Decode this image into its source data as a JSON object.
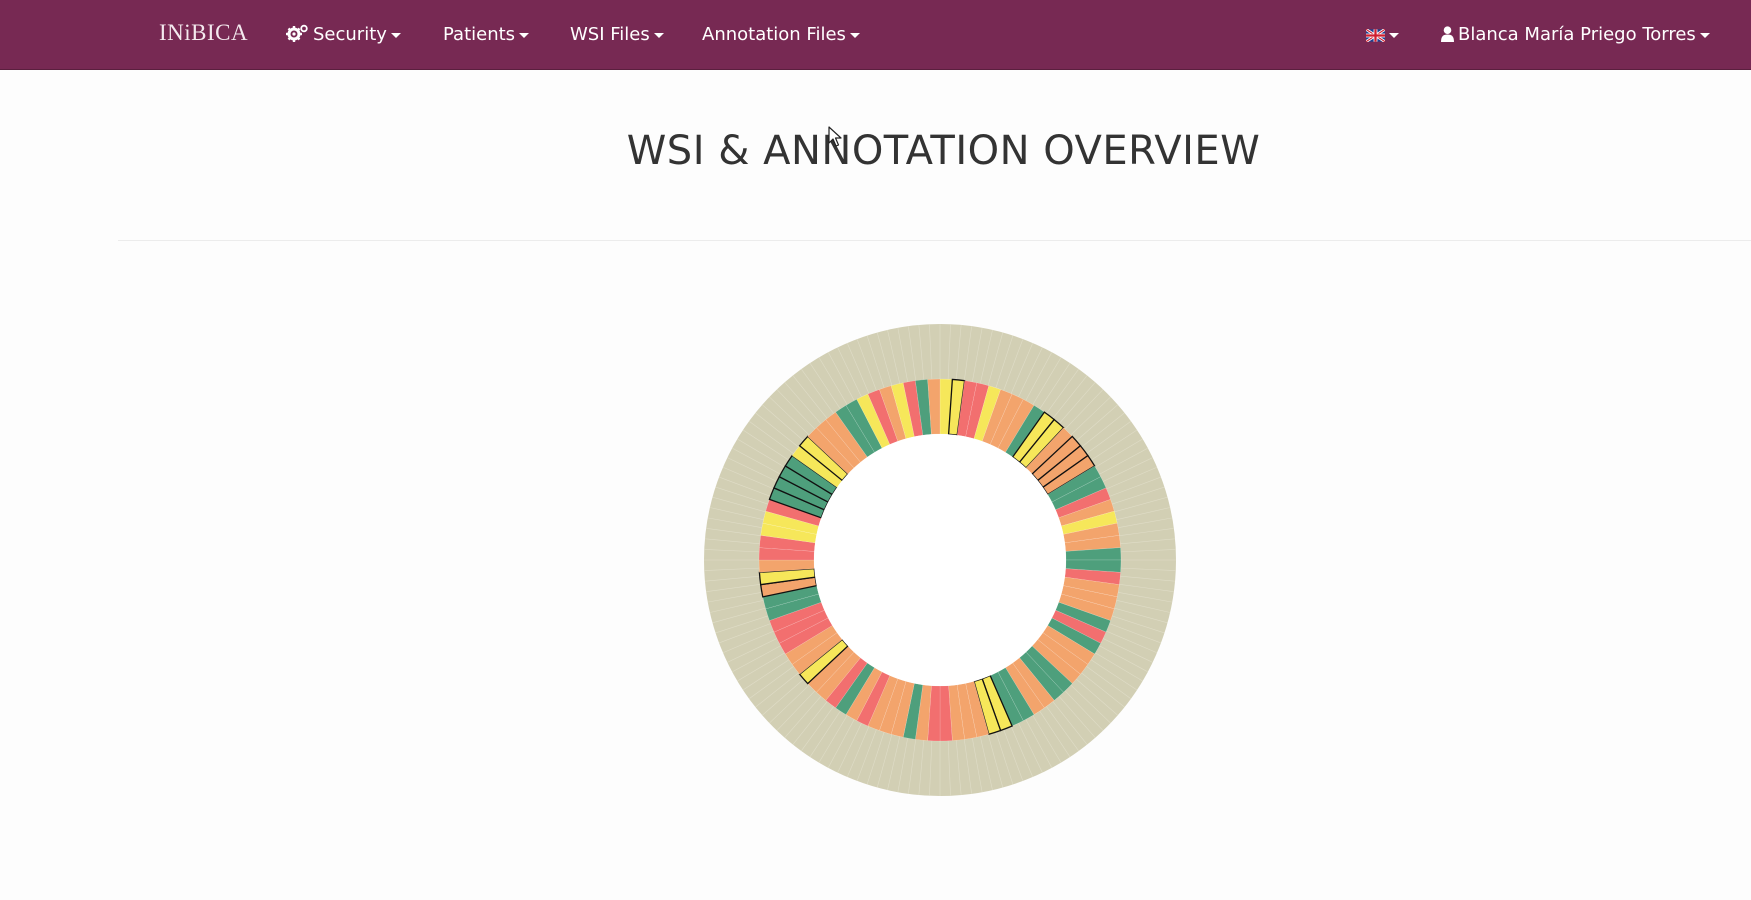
{
  "navbar": {
    "brand": "INiBICA",
    "items": [
      {
        "label": "Security",
        "icon": "cogs-icon"
      },
      {
        "label": "Patients"
      },
      {
        "label": "WSI Files"
      },
      {
        "label": "Annotation Files"
      }
    ],
    "language": {
      "icon": "uk-flag-icon"
    },
    "user": {
      "label": "Blanca María Priego Torres",
      "icon": "user-icon"
    },
    "background_color": "#772953"
  },
  "main": {
    "title": "WSI & ANNOTATION OVERVIEW"
  },
  "chart_data": {
    "type": "donut",
    "outer_ring_color": "#d2cfb4",
    "palette": {
      "green": "#4e9f7c",
      "salmon": "#f3a46c",
      "red": "#f26f6f",
      "yellow": "#f6e75a",
      "gray": "#d2cfb4"
    },
    "inner_segments": [
      "yellow",
      "yellow",
      "red",
      "red",
      "yellow",
      "salmon",
      "salmon",
      "salmon",
      "green",
      "yellow",
      "yellow",
      "salmon",
      "salmon",
      "salmon",
      "salmon",
      "green",
      "green",
      "red",
      "salmon",
      "yellow",
      "salmon",
      "salmon",
      "green",
      "green",
      "red",
      "salmon",
      "salmon",
      "salmon",
      "green",
      "red",
      "green",
      "salmon",
      "salmon",
      "salmon",
      "green",
      "green",
      "salmon",
      "salmon",
      "green",
      "green",
      "yellow",
      "yellow",
      "salmon",
      "salmon",
      "salmon",
      "red",
      "red",
      "salmon",
      "green",
      "salmon",
      "salmon",
      "salmon",
      "red",
      "salmon",
      "green",
      "red",
      "salmon",
      "salmon",
      "yellow",
      "salmon",
      "salmon",
      "red",
      "red",
      "red",
      "green",
      "green",
      "salmon",
      "yellow",
      "salmon",
      "red",
      "red",
      "yellow",
      "yellow",
      "red",
      "green",
      "green",
      "green",
      "green",
      "yellow",
      "yellow",
      "salmon",
      "salmon",
      "salmon",
      "green",
      "green",
      "yellow",
      "red",
      "salmon",
      "yellow",
      "red",
      "green",
      "salmon"
    ],
    "outlined_segments": [
      1,
      9,
      10,
      12,
      13,
      14,
      40,
      41,
      58,
      66,
      67,
      74,
      75,
      76,
      77,
      79
    ]
  }
}
